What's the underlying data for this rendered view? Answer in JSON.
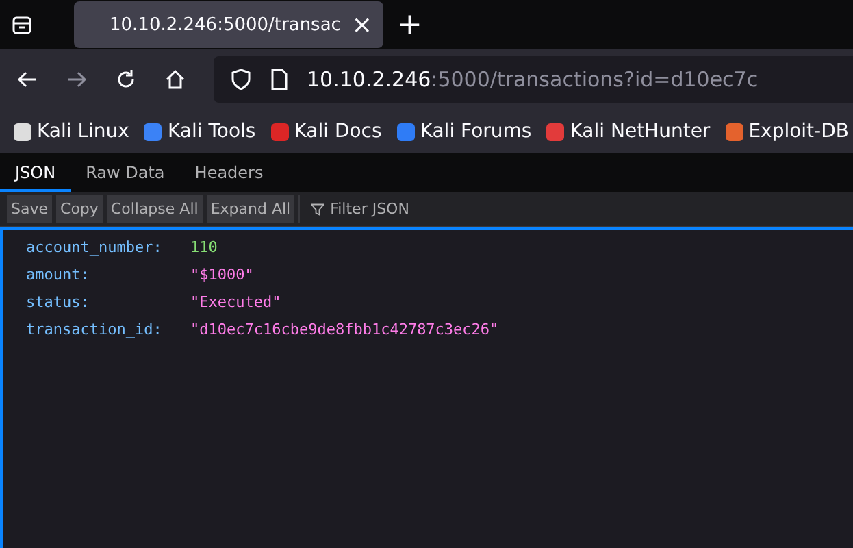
{
  "browser": {
    "tab": {
      "title": "10.10.2.246:5000/transac",
      "close": "×"
    },
    "new_tab": "+",
    "url": {
      "host": "10.10.2.246",
      "rest": ":5000/transactions?id=d10ec7c"
    },
    "bookmarks": [
      {
        "label": "Kali Linux",
        "color": "#dddddd"
      },
      {
        "label": "Kali Tools",
        "color": "#3b82f6"
      },
      {
        "label": "Kali Docs",
        "color": "#dc2626"
      },
      {
        "label": "Kali Forums",
        "color": "#2f7cf6"
      },
      {
        "label": "Kali NetHunter",
        "color": "#e23b3b"
      },
      {
        "label": "Exploit-DB",
        "color": "#e4622d"
      }
    ]
  },
  "viewer": {
    "tabs": [
      {
        "label": "JSON",
        "selected": true
      },
      {
        "label": "Raw Data",
        "selected": false
      },
      {
        "label": "Headers",
        "selected": false
      }
    ],
    "buttons": [
      "Save",
      "Copy",
      "Collapse All",
      "Expand All"
    ],
    "filter": {
      "placeholder": "Filter JSON"
    },
    "rows": [
      {
        "key": "account_number:",
        "value": "110",
        "kind": "number"
      },
      {
        "key": "amount:",
        "value": "\"$1000\"",
        "kind": "string"
      },
      {
        "key": "status:",
        "value": "\"Executed\"",
        "kind": "string"
      },
      {
        "key": "transaction_id:",
        "value": "\"d10ec7c16cbe9de8fbb1c42787c3ec26\"",
        "kind": "string"
      }
    ]
  }
}
